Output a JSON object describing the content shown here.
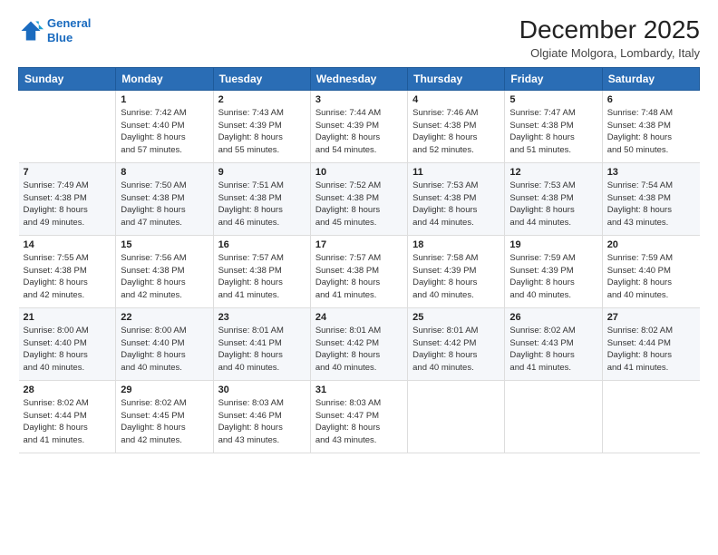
{
  "logo": {
    "line1": "General",
    "line2": "Blue"
  },
  "title": "December 2025",
  "subtitle": "Olgiate Molgora, Lombardy, Italy",
  "days_header": [
    "Sunday",
    "Monday",
    "Tuesday",
    "Wednesday",
    "Thursday",
    "Friday",
    "Saturday"
  ],
  "weeks": [
    [
      {
        "day": "",
        "info": ""
      },
      {
        "day": "1",
        "info": "Sunrise: 7:42 AM\nSunset: 4:40 PM\nDaylight: 8 hours\nand 57 minutes."
      },
      {
        "day": "2",
        "info": "Sunrise: 7:43 AM\nSunset: 4:39 PM\nDaylight: 8 hours\nand 55 minutes."
      },
      {
        "day": "3",
        "info": "Sunrise: 7:44 AM\nSunset: 4:39 PM\nDaylight: 8 hours\nand 54 minutes."
      },
      {
        "day": "4",
        "info": "Sunrise: 7:46 AM\nSunset: 4:38 PM\nDaylight: 8 hours\nand 52 minutes."
      },
      {
        "day": "5",
        "info": "Sunrise: 7:47 AM\nSunset: 4:38 PM\nDaylight: 8 hours\nand 51 minutes."
      },
      {
        "day": "6",
        "info": "Sunrise: 7:48 AM\nSunset: 4:38 PM\nDaylight: 8 hours\nand 50 minutes."
      }
    ],
    [
      {
        "day": "7",
        "info": "Sunrise: 7:49 AM\nSunset: 4:38 PM\nDaylight: 8 hours\nand 49 minutes."
      },
      {
        "day": "8",
        "info": "Sunrise: 7:50 AM\nSunset: 4:38 PM\nDaylight: 8 hours\nand 47 minutes."
      },
      {
        "day": "9",
        "info": "Sunrise: 7:51 AM\nSunset: 4:38 PM\nDaylight: 8 hours\nand 46 minutes."
      },
      {
        "day": "10",
        "info": "Sunrise: 7:52 AM\nSunset: 4:38 PM\nDaylight: 8 hours\nand 45 minutes."
      },
      {
        "day": "11",
        "info": "Sunrise: 7:53 AM\nSunset: 4:38 PM\nDaylight: 8 hours\nand 44 minutes."
      },
      {
        "day": "12",
        "info": "Sunrise: 7:53 AM\nSunset: 4:38 PM\nDaylight: 8 hours\nand 44 minutes."
      },
      {
        "day": "13",
        "info": "Sunrise: 7:54 AM\nSunset: 4:38 PM\nDaylight: 8 hours\nand 43 minutes."
      }
    ],
    [
      {
        "day": "14",
        "info": "Sunrise: 7:55 AM\nSunset: 4:38 PM\nDaylight: 8 hours\nand 42 minutes."
      },
      {
        "day": "15",
        "info": "Sunrise: 7:56 AM\nSunset: 4:38 PM\nDaylight: 8 hours\nand 42 minutes."
      },
      {
        "day": "16",
        "info": "Sunrise: 7:57 AM\nSunset: 4:38 PM\nDaylight: 8 hours\nand 41 minutes."
      },
      {
        "day": "17",
        "info": "Sunrise: 7:57 AM\nSunset: 4:38 PM\nDaylight: 8 hours\nand 41 minutes."
      },
      {
        "day": "18",
        "info": "Sunrise: 7:58 AM\nSunset: 4:39 PM\nDaylight: 8 hours\nand 40 minutes."
      },
      {
        "day": "19",
        "info": "Sunrise: 7:59 AM\nSunset: 4:39 PM\nDaylight: 8 hours\nand 40 minutes."
      },
      {
        "day": "20",
        "info": "Sunrise: 7:59 AM\nSunset: 4:40 PM\nDaylight: 8 hours\nand 40 minutes."
      }
    ],
    [
      {
        "day": "21",
        "info": "Sunrise: 8:00 AM\nSunset: 4:40 PM\nDaylight: 8 hours\nand 40 minutes."
      },
      {
        "day": "22",
        "info": "Sunrise: 8:00 AM\nSunset: 4:40 PM\nDaylight: 8 hours\nand 40 minutes."
      },
      {
        "day": "23",
        "info": "Sunrise: 8:01 AM\nSunset: 4:41 PM\nDaylight: 8 hours\nand 40 minutes."
      },
      {
        "day": "24",
        "info": "Sunrise: 8:01 AM\nSunset: 4:42 PM\nDaylight: 8 hours\nand 40 minutes."
      },
      {
        "day": "25",
        "info": "Sunrise: 8:01 AM\nSunset: 4:42 PM\nDaylight: 8 hours\nand 40 minutes."
      },
      {
        "day": "26",
        "info": "Sunrise: 8:02 AM\nSunset: 4:43 PM\nDaylight: 8 hours\nand 41 minutes."
      },
      {
        "day": "27",
        "info": "Sunrise: 8:02 AM\nSunset: 4:44 PM\nDaylight: 8 hours\nand 41 minutes."
      }
    ],
    [
      {
        "day": "28",
        "info": "Sunrise: 8:02 AM\nSunset: 4:44 PM\nDaylight: 8 hours\nand 41 minutes."
      },
      {
        "day": "29",
        "info": "Sunrise: 8:02 AM\nSunset: 4:45 PM\nDaylight: 8 hours\nand 42 minutes."
      },
      {
        "day": "30",
        "info": "Sunrise: 8:03 AM\nSunset: 4:46 PM\nDaylight: 8 hours\nand 43 minutes."
      },
      {
        "day": "31",
        "info": "Sunrise: 8:03 AM\nSunset: 4:47 PM\nDaylight: 8 hours\nand 43 minutes."
      },
      {
        "day": "",
        "info": ""
      },
      {
        "day": "",
        "info": ""
      },
      {
        "day": "",
        "info": ""
      }
    ]
  ]
}
